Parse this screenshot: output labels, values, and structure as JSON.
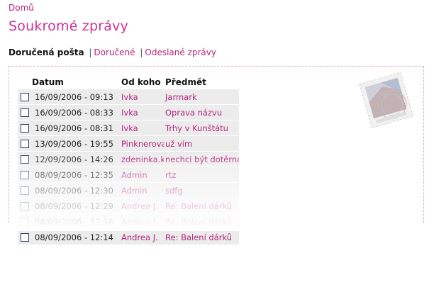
{
  "breadcrumb": {
    "home": "Domů"
  },
  "page": {
    "title": "Soukromé zprávy"
  },
  "mailnav": {
    "inbox": "Doručená pošta",
    "sep1": "|",
    "delivered": "Doručené",
    "sep2": "|",
    "sent": "Odeslané zprávy"
  },
  "table": {
    "headers": {
      "date": "Datum",
      "from": "Od koho",
      "subject": "Předmět"
    },
    "rows": [
      {
        "date": "16/09/2006 - 09:13",
        "from": "Ivka",
        "subject": "Jarmark"
      },
      {
        "date": "16/09/2006 - 08:33",
        "from": "Ivka",
        "subject": "Oprava názvu"
      },
      {
        "date": "16/09/2006 - 08:31",
        "from": "Ivka",
        "subject": "Trhy v Kunštátu"
      },
      {
        "date": "13/09/2006 - 19:55",
        "from": "Pinknerova",
        "subject": "už vím"
      },
      {
        "date": "12/09/2006 - 14:26",
        "from": "zdeninka.k",
        "subject": "nechci být dotěrná"
      },
      {
        "date": "08/09/2006 - 12:35",
        "from": "Admin",
        "subject": "rtz"
      },
      {
        "date": "08/09/2006 - 12:30",
        "from": "Admin",
        "subject": "sdfg"
      },
      {
        "date": "08/09/2006 - 12:29",
        "from": "Andrea J.",
        "subject": "Re: Balení dárků"
      },
      {
        "date": "08/09/2006 - 12:16",
        "from": "Andrea J.",
        "subject": "Re: Balení dárků"
      },
      {
        "date": "08/09/2006 - 12:14",
        "from": "Andrea J.",
        "subject": "Re: Balení dárků"
      }
    ]
  },
  "colors": {
    "accent": "#cc3399",
    "link": "#b3247a",
    "row_bg": "#ececec",
    "border": "#e6a9cd"
  },
  "icons": {
    "stamp": "postage-stamp-icon",
    "checkbox": "checkbox"
  }
}
